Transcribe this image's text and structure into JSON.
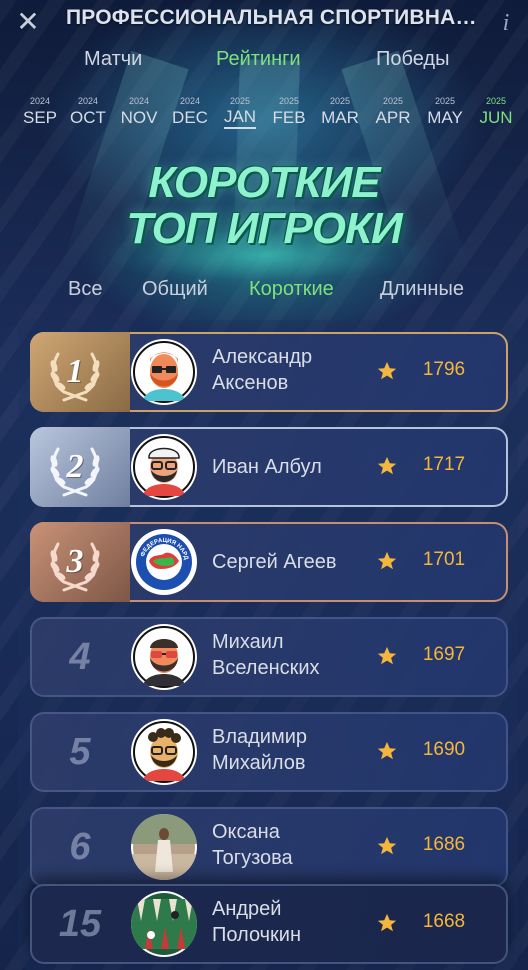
{
  "header": {
    "title": "ПРОФЕССИОНАЛЬНАЯ СПОРТИВНАЯ …",
    "close_icon": "close-icon",
    "info_icon": "info-icon",
    "info_glyph": "i",
    "close_glyph": "✕"
  },
  "tabs": [
    {
      "label": "Матчи",
      "active": false
    },
    {
      "label": "Рейтинги",
      "active": true
    },
    {
      "label": "Победы",
      "active": false
    }
  ],
  "months": [
    {
      "year": "2024",
      "name": "SEP",
      "selected": false,
      "current": false
    },
    {
      "year": "2024",
      "name": "OCT",
      "selected": false,
      "current": false
    },
    {
      "year": "2024",
      "name": "NOV",
      "selected": false,
      "current": false
    },
    {
      "year": "2024",
      "name": "DEC",
      "selected": false,
      "current": false
    },
    {
      "year": "2025",
      "name": "JAN",
      "selected": true,
      "current": false
    },
    {
      "year": "2025",
      "name": "FEB",
      "selected": false,
      "current": false
    },
    {
      "year": "2025",
      "name": "MAR",
      "selected": false,
      "current": false
    },
    {
      "year": "2025",
      "name": "APR",
      "selected": false,
      "current": false
    },
    {
      "year": "2025",
      "name": "MAY",
      "selected": false,
      "current": false
    },
    {
      "year": "2025",
      "name": "JUN",
      "selected": false,
      "current": true
    }
  ],
  "hero": {
    "line1": "КОРОТКИЕ",
    "line2": "ТОП ИГРОКИ"
  },
  "filters": [
    {
      "label": "Все",
      "active": false
    },
    {
      "label": "Общий",
      "active": false
    },
    {
      "label": "Короткие",
      "active": true
    },
    {
      "label": "Длинные",
      "active": false
    }
  ],
  "players": [
    {
      "rank": "1",
      "medal": "gold",
      "first": "Александр",
      "last": "Аксенов",
      "score": "1796",
      "avatar": "avatar-red-beard-glasses"
    },
    {
      "rank": "2",
      "medal": "silver",
      "first": "Иван Албул",
      "last": "",
      "score": "1717",
      "avatar": "avatar-cap-glasses"
    },
    {
      "rank": "3",
      "medal": "bronze",
      "first": "Сергей Агеев",
      "last": "",
      "score": "1701",
      "avatar": "avatar-federation-logo"
    },
    {
      "rank": "4",
      "medal": "none",
      "first": "Михаил",
      "last": "Вселенских",
      "score": "1697",
      "avatar": "avatar-dark-beard-sunglasses"
    },
    {
      "rank": "5",
      "medal": "none",
      "first": "Владимир",
      "last": "Михайлов",
      "score": "1690",
      "avatar": "avatar-curly-hair-glasses"
    },
    {
      "rank": "6",
      "medal": "none",
      "first": "Оксана",
      "last": "Тогузова",
      "score": "1686",
      "avatar": "avatar-photo-woman"
    },
    {
      "rank": "15",
      "medal": "none",
      "first": "Андрей",
      "last": "Полочкин",
      "score": "1668",
      "avatar": "avatar-backgammon-board"
    }
  ],
  "federation_logo_text": "ФЕДЕРАЦИЯ НАРД",
  "colors": {
    "accent_green": "#7ee07e",
    "score_gold": "#f4b63c",
    "hero_mint": "#8ff2cf"
  }
}
